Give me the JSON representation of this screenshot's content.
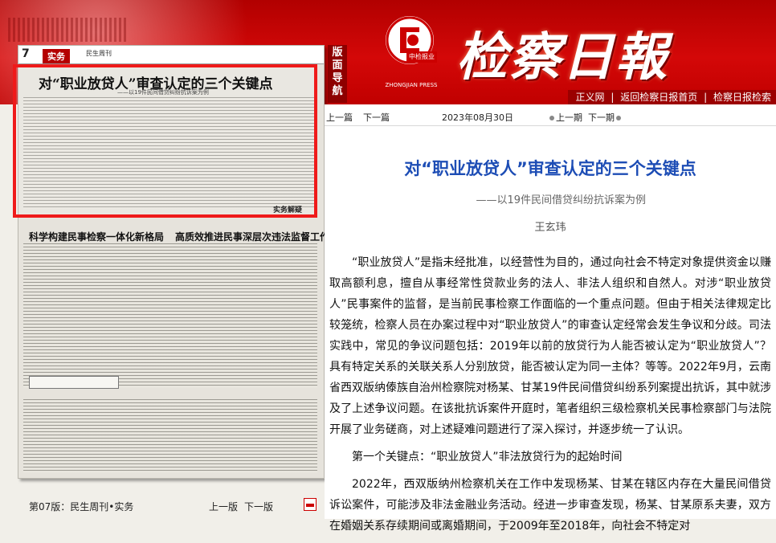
{
  "header": {
    "masthead": "检察日報",
    "nav_tag": "版面导航",
    "logo_seal": "中检报业",
    "logo_press": "ZHONGJIAN PRESS",
    "links": [
      "正义网",
      "返回检察日报首页",
      "检察日报检索"
    ],
    "separator": "|"
  },
  "newspaper_page": {
    "page_number": "7",
    "section": "实务",
    "weekly": "民生周刊",
    "featured_title": "对“职业放贷人”审查认定的三个关键点",
    "featured_subtitle": "——以19件民间借贷纠纷抗诉案为例",
    "column_label": "实务解疑",
    "headline_2": "科学构建民事检察一体化新格局",
    "headline_3": "高质效推进民事深层次违法监督工作"
  },
  "bottom_nav": {
    "page_label": "第07版：民生周刊•实务",
    "prev_page": "上一版",
    "next_page": "下一版"
  },
  "article_nav": {
    "prev_article": "上一篇",
    "next_article": "下一篇",
    "date": "2023年08月30日",
    "prev_issue": "上一期",
    "next_issue": "下一期"
  },
  "article": {
    "title": "对“职业放贷人”审查认定的三个关键点",
    "subtitle": "——以19件民间借贷纠纷抗诉案为例",
    "author": "王玄玮",
    "paragraphs": [
      "“职业放贷人”是指未经批准，以经营性为目的，通过向社会不特定对象提供资金以赚取高额利息，擅自从事经常性贷款业务的法人、非法人组织和自然人。对涉“职业放贷人”民事案件的监督，是当前民事检察工作面临的一个重点问题。但由于相关法律规定比较笼统，检察人员在办案过程中对“职业放贷人”的审查认定经常会发生争议和分歧。司法实践中，常见的争议问题包括：2019年以前的放贷行为人能否被认定为“职业放贷人”？具有特定关系的关联关系人分别放贷，能否被认定为同一主体？等等。2022年9月，云南省西双版纳傣族自治州检察院对杨某、甘某19件民间借贷纠纷系列案提出抗诉，其中就涉及了上述争议问题。在该批抗诉案件开庭时，笔者组织三级检察机关民事检察部门与法院开展了业务磋商，对上述疑难问题进行了深入探讨，并逐步统一了认识。",
      "第一个关键点：“职业放贷人”非法放贷行为的起始时间",
      "2022年，西双版纳州检察机关在工作中发现杨某、甘某在辖区内存在大量民间借贷诉讼案件，可能涉及非法金融业务活动。经进一步审查发现，杨某、甘某原系夫妻，双方在婚姻关系存续期间或离婚期间，于2009年至2018年，向社会不特定对"
    ]
  }
}
